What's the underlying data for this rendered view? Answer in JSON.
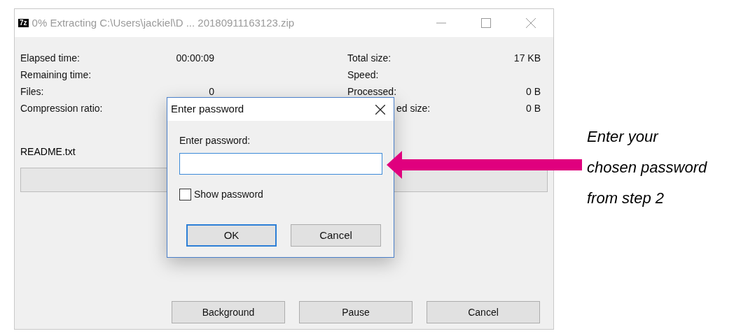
{
  "window": {
    "title": "0% Extracting C:\\Users\\jackiel\\D ... 20180911163123.zip",
    "logo": "7z"
  },
  "stats_left": [
    {
      "label": "Elapsed time:",
      "value": "00:00:09"
    },
    {
      "label": "Remaining time:"
    },
    {
      "label": "Files:",
      "value": "0"
    },
    {
      "label": "Compression ratio:"
    }
  ],
  "stats_right": [
    {
      "label": "Total size:",
      "value": "17 KB",
      "covered": false
    },
    {
      "label": "Speed:",
      "covered": false
    },
    {
      "label": "Processed:",
      "value": "0 B",
      "covered": false
    },
    {
      "label": "ed size:",
      "value": "0 B",
      "covered": true
    }
  ],
  "current_file": "README.txt",
  "progress": {
    "level": 0
  },
  "buttons": [
    "Background",
    "Pause",
    "Cancel"
  ],
  "dialog": {
    "title": "Enter password",
    "field_label": "Enter password:",
    "show_password": {
      "label": "Show password",
      "checked": false
    },
    "buttons": [
      {
        "label": "OK",
        "default": true
      },
      {
        "label": "Cancel",
        "default": false
      }
    ]
  },
  "annotation": {
    "lines": [
      "Enter your",
      "chosen password",
      "from step 2"
    ]
  }
}
